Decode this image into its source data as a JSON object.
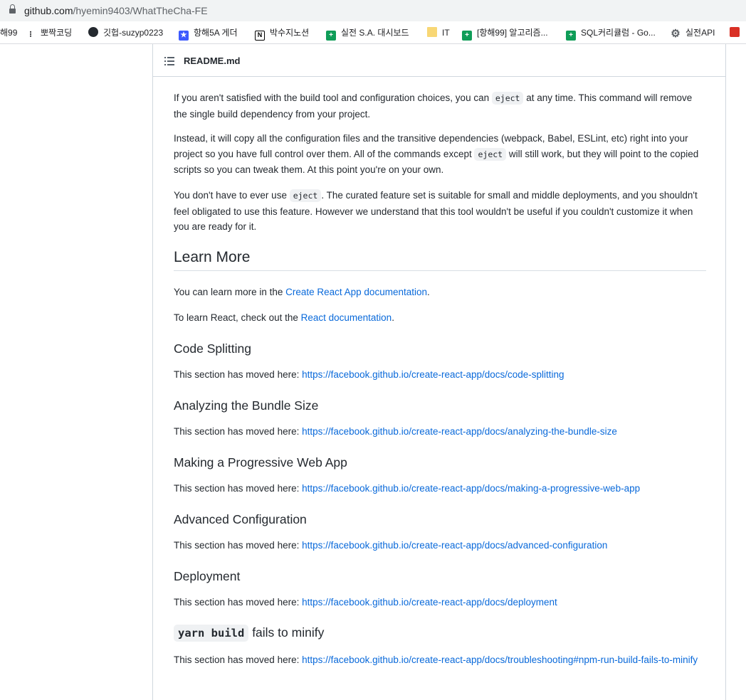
{
  "browser": {
    "url_host": "github.com",
    "url_path": "/hyemin9403/WhatTheCha-FE"
  },
  "bookmarks": [
    {
      "label": "해99",
      "icon": "none"
    },
    {
      "label": "뽀짝코딩",
      "icon": "dots-icon"
    },
    {
      "label": "깃헙-suzyp0223",
      "icon": "github-icon"
    },
    {
      "label": "항해5A 게더",
      "icon": "app-icon"
    },
    {
      "label": "박수지노션",
      "icon": "notion-icon"
    },
    {
      "label": "실전 S.A. 대시보드",
      "icon": "sheets-icon"
    },
    {
      "label": "IT",
      "icon": "folder-icon"
    },
    {
      "label": "[항해99] 알고리즘...",
      "icon": "sheets-icon"
    },
    {
      "label": "SQL커리큘럼 - Go...",
      "icon": "sheets-icon"
    },
    {
      "label": "실전API",
      "icon": "gear-icon"
    }
  ],
  "readme": {
    "filename": "README.md",
    "eject_p1_a": "If you aren't satisfied with the build tool and configuration choices, you can ",
    "eject_code": "eject",
    "eject_p1_b": " at any time. This command will remove the single build dependency from your project.",
    "eject_p2_a": "Instead, it will copy all the configuration files and the transitive dependencies (webpack, Babel, ESLint, etc) right into your project so you have full control over them. All of the commands except ",
    "eject_p2_b": " will still work, but they will point to the copied scripts so you can tweak them. At this point you're on your own.",
    "eject_p3_a": "You don't have to ever use ",
    "eject_p3_b": ". The curated feature set is suitable for small and middle deployments, and you shouldn't feel obligated to use this feature. However we understand that this tool wouldn't be useful if you couldn't customize it when you are ready for it.",
    "learn_more": {
      "heading": "Learn More",
      "p1_a": "You can learn more in the ",
      "p1_link": "Create React App documentation",
      "p1_b": ".",
      "p2_a": "To learn React, check out the ",
      "p2_link": "React documentation",
      "p2_b": "."
    },
    "moved_prefix": "This section has moved here: ",
    "sections": [
      {
        "heading": "Code Splitting",
        "link": "https://facebook.github.io/create-react-app/docs/code-splitting"
      },
      {
        "heading": "Analyzing the Bundle Size",
        "link": "https://facebook.github.io/create-react-app/docs/analyzing-the-bundle-size"
      },
      {
        "heading": "Making a Progressive Web App",
        "link": "https://facebook.github.io/create-react-app/docs/making-a-progressive-web-app"
      },
      {
        "heading": "Advanced Configuration",
        "link": "https://facebook.github.io/create-react-app/docs/advanced-configuration"
      },
      {
        "heading": "Deployment",
        "link": "https://facebook.github.io/create-react-app/docs/deployment"
      }
    ],
    "last_section": {
      "heading_code": "yarn build",
      "heading_text": " fails to minify",
      "link": "https://facebook.github.io/create-react-app/docs/troubleshooting#npm-run-build-fails-to-minify"
    }
  }
}
